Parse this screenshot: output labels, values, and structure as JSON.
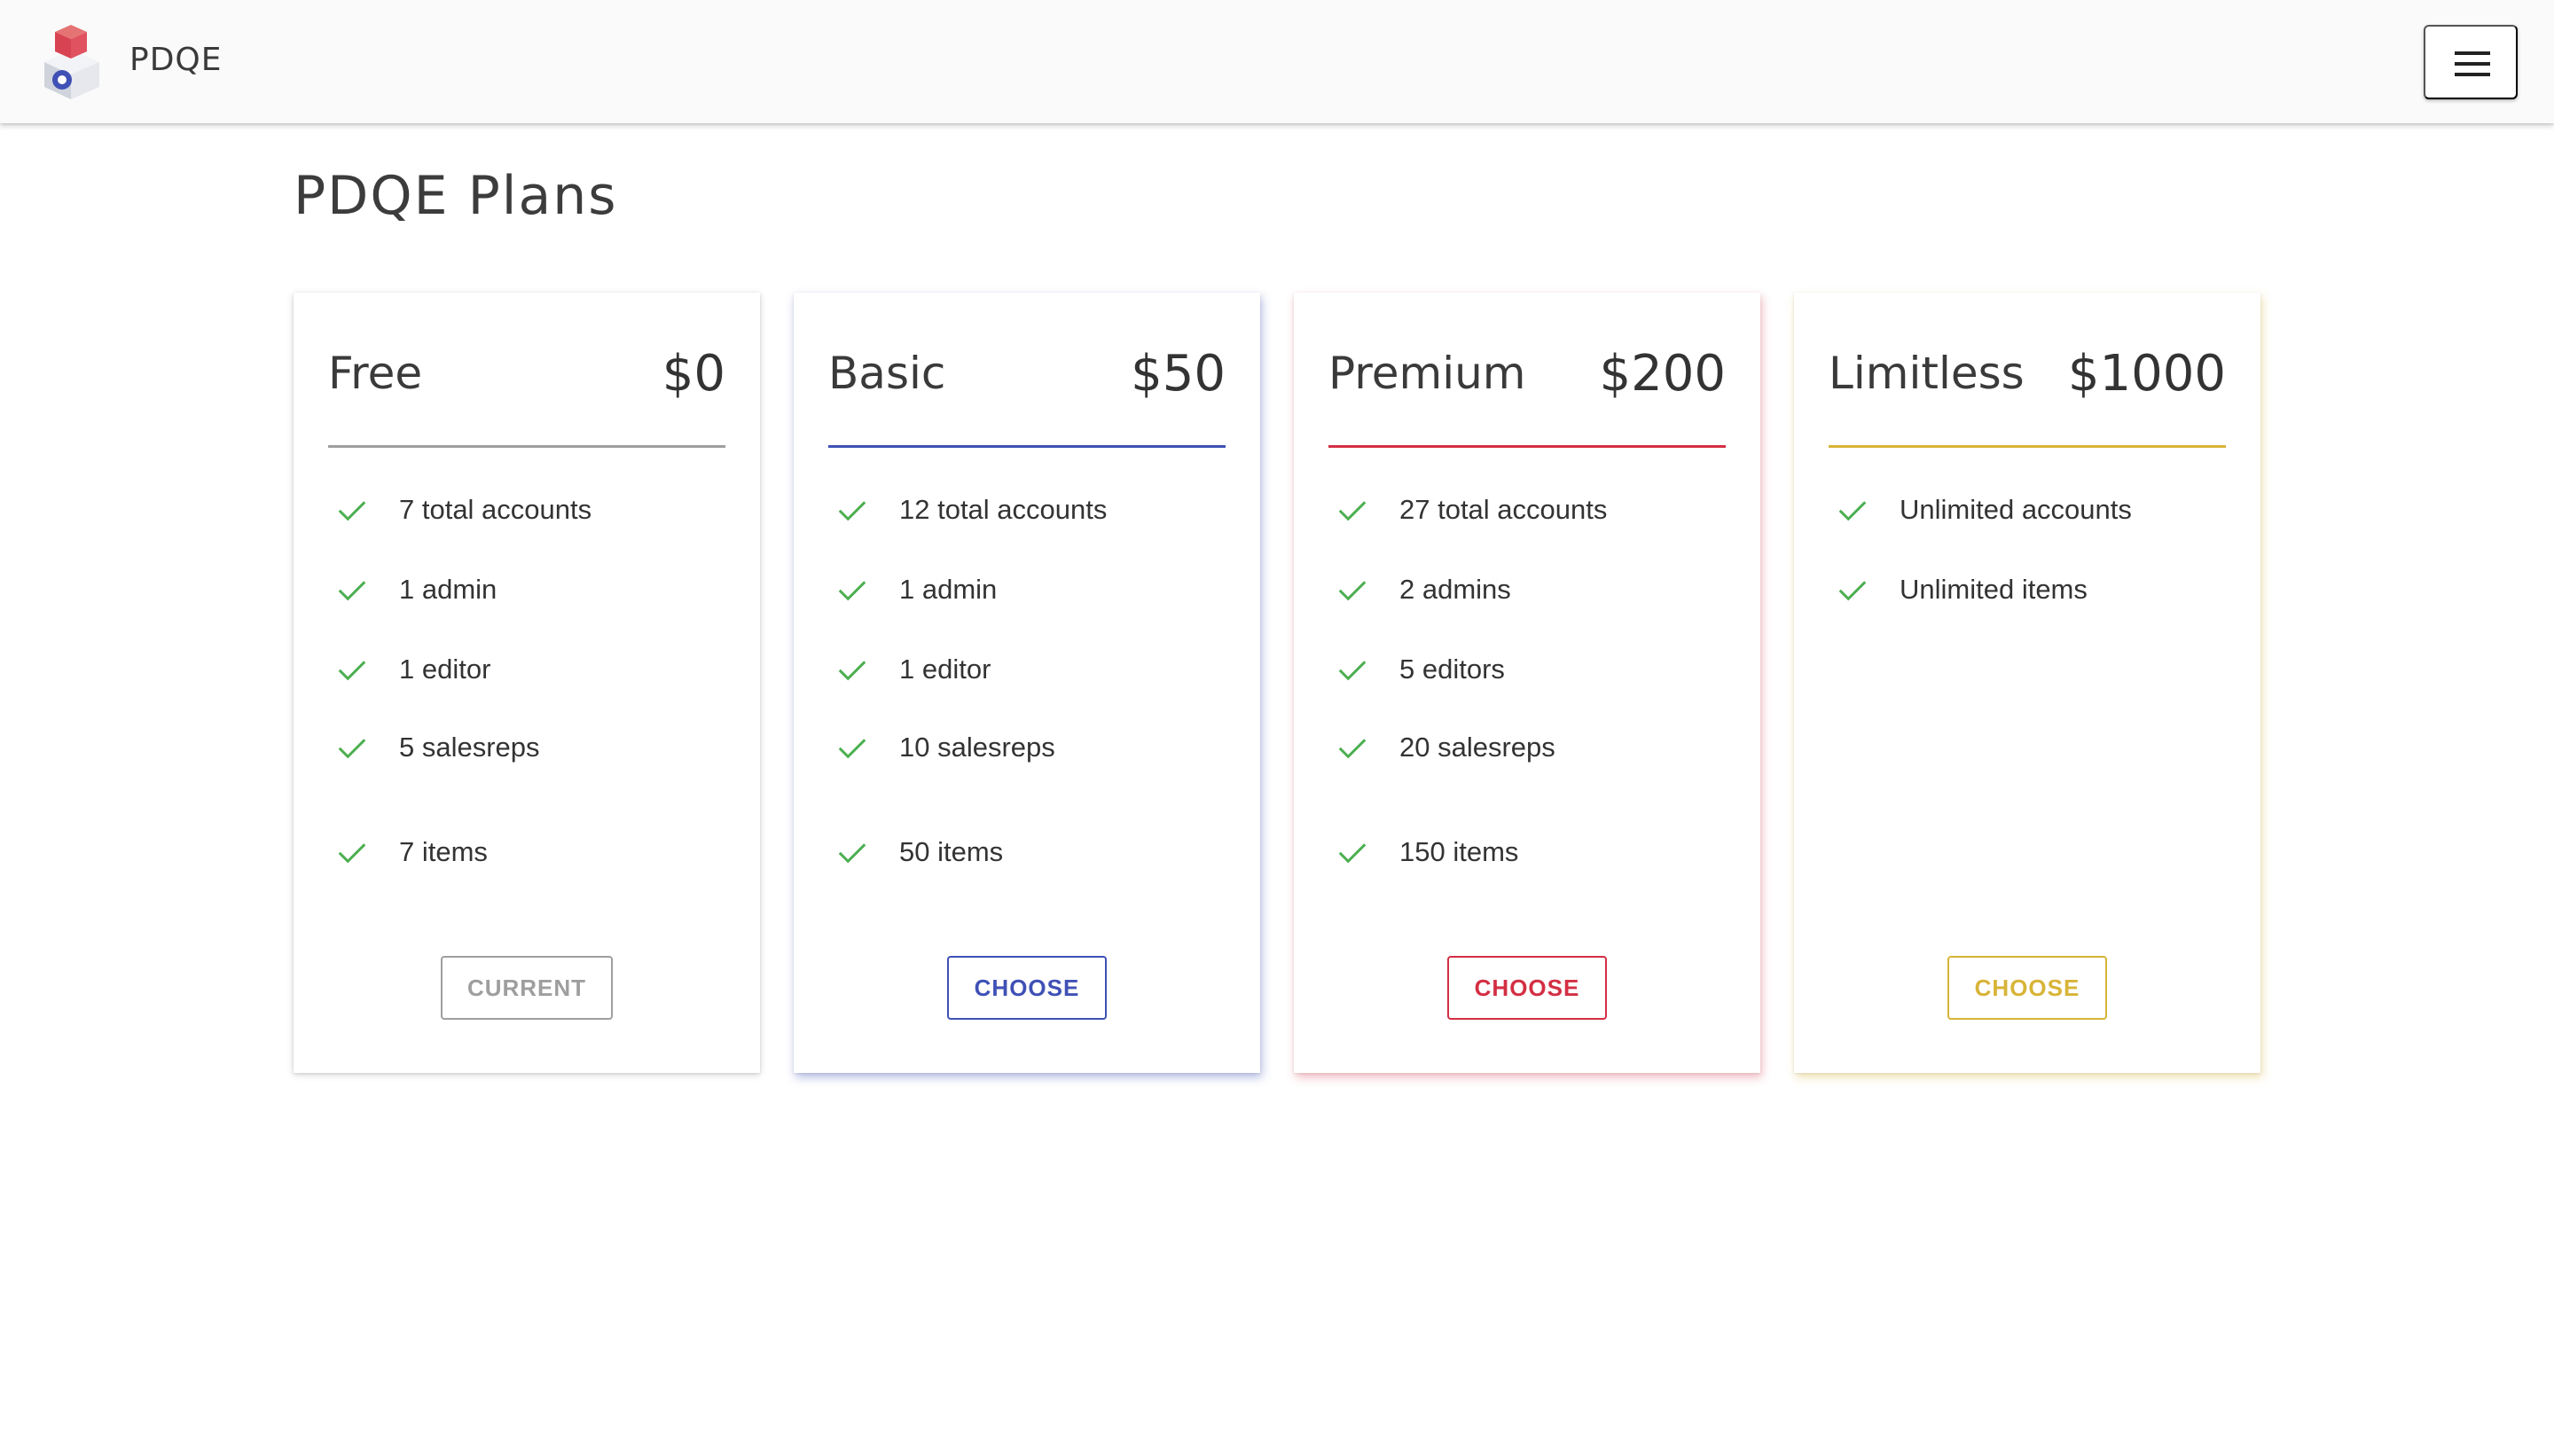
{
  "header": {
    "brand": "PDQE",
    "logo_icon": "cube-box-logo-icon",
    "menu_icon": "hamburger-menu-icon"
  },
  "page": {
    "title": "PDQE Plans"
  },
  "colors": {
    "free": "#9e9e9e",
    "basic": "#3f51b5",
    "premium": "#d32f44",
    "limitless": "#d8b438",
    "check": "#4caf50"
  },
  "plans": [
    {
      "name": "Free",
      "price": "$0",
      "features": [
        "7 total accounts",
        "1 admin",
        "1 editor",
        "5 salesreps",
        "7 items"
      ],
      "button": "CURRENT"
    },
    {
      "name": "Basic",
      "price": "$50",
      "features": [
        "12 total accounts",
        "1 admin",
        "1 editor",
        "10 salesreps",
        "50 items"
      ],
      "button": "CHOOSE"
    },
    {
      "name": "Premium",
      "price": "$200",
      "features": [
        "27 total accounts",
        "2 admins",
        "5 editors",
        "20 salesreps",
        "150 items"
      ],
      "button": "CHOOSE"
    },
    {
      "name": "Limitless",
      "price": "$1000",
      "features": [
        "Unlimited accounts",
        "Unlimited items"
      ],
      "button": "CHOOSE"
    }
  ]
}
